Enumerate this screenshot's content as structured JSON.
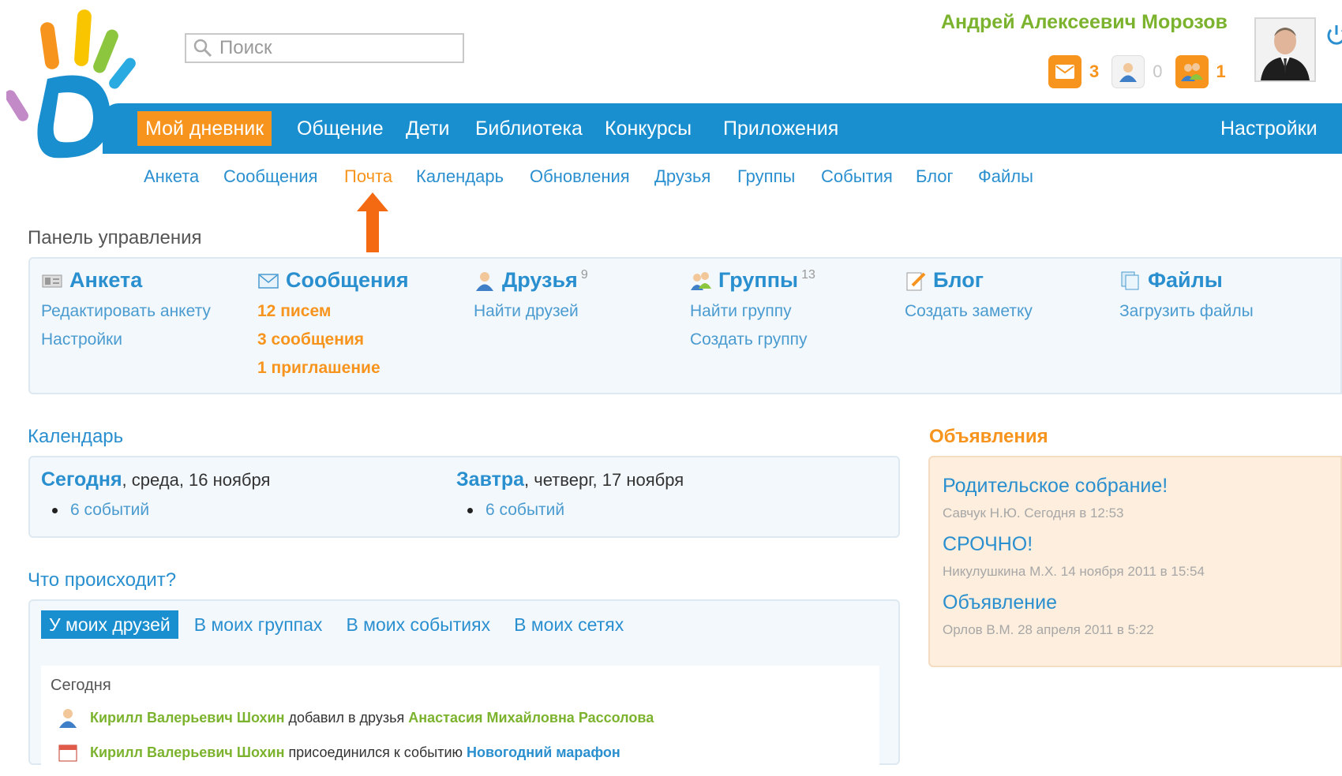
{
  "search": {
    "placeholder": "Поиск"
  },
  "user": {
    "name": "Андрей Алексеевич Морозов",
    "counters": [
      {
        "icon": "mail-icon",
        "count": "3"
      },
      {
        "icon": "friend-request-icon",
        "count": "0"
      },
      {
        "icon": "group-invite-icon",
        "count": "1"
      }
    ]
  },
  "main_nav": {
    "items": [
      "Мой дневник",
      "Общение",
      "Дети",
      "Библиотека",
      "Конкурсы",
      "Приложения"
    ],
    "active": "Мой дневник",
    "settings": "Настройки"
  },
  "sub_nav": {
    "items": [
      "Анкета",
      "Сообщения",
      "Почта",
      "Календарь",
      "Обновления",
      "Друзья",
      "Группы",
      "События",
      "Блог",
      "Файлы"
    ],
    "active": "Почта"
  },
  "panel": {
    "title": "Панель управления",
    "columns": [
      {
        "title": "Анкета",
        "icon": "profile-card-icon",
        "count": "",
        "links": [
          "Редактировать анкету",
          "Настройки"
        ]
      },
      {
        "title": "Сообщения",
        "icon": "envelope-icon",
        "count": "",
        "links": [
          "12 писем",
          "3 сообщения",
          "1 приглашение"
        ]
      },
      {
        "title": "Друзья",
        "icon": "friend-icon",
        "count": "9",
        "links": [
          "Найти друзей"
        ]
      },
      {
        "title": "Группы",
        "icon": "group-icon",
        "count": "13",
        "links": [
          "Найти группу",
          "Создать группу"
        ]
      },
      {
        "title": "Блог",
        "icon": "pencil-note-icon",
        "count": "",
        "links": [
          "Создать заметку"
        ]
      },
      {
        "title": "Файлы",
        "icon": "files-icon",
        "count": "",
        "links": [
          "Загрузить файлы"
        ]
      }
    ]
  },
  "calendar": {
    "title": "Календарь",
    "today": {
      "label": "Сегодня",
      "date": ", среда, 16 ноября",
      "events": "6 событий"
    },
    "tomorrow": {
      "label": "Завтра",
      "date": ", четверг, 17 ноября",
      "events": "6 событий"
    }
  },
  "announcements": {
    "title": "Объявления",
    "items": [
      {
        "title": "Родительское собрание!",
        "meta": "Савчук Н.Ю. Сегодня в 12:53"
      },
      {
        "title": "СРОЧНО!",
        "meta": "Никулушкина М.Х. 14 ноября 2011 в 15:54"
      },
      {
        "title": "Объявление",
        "meta": "Орлов В.М. 28 апреля 2011 в 5:22"
      }
    ]
  },
  "feed": {
    "title": "Что происходит?",
    "tabs": [
      "У моих друзей",
      "В моих группах",
      "В моих событиях",
      "В моих сетях"
    ],
    "active_tab": "У моих друзей",
    "date_label": "Сегодня",
    "rows": [
      {
        "actor": "Кирилл Валерьевич Шохин",
        "action": " добавил в друзья ",
        "target": "Анастасия Михайловна Рассолова"
      },
      {
        "actor": "Кирилл Валерьевич Шохин",
        "action": " присоединился к событию ",
        "target": "Новогодний марафон"
      }
    ]
  },
  "colors": {
    "accent_blue": "#1a8fd0",
    "accent_orange": "#f7941d",
    "name_green": "#7cb32e"
  }
}
